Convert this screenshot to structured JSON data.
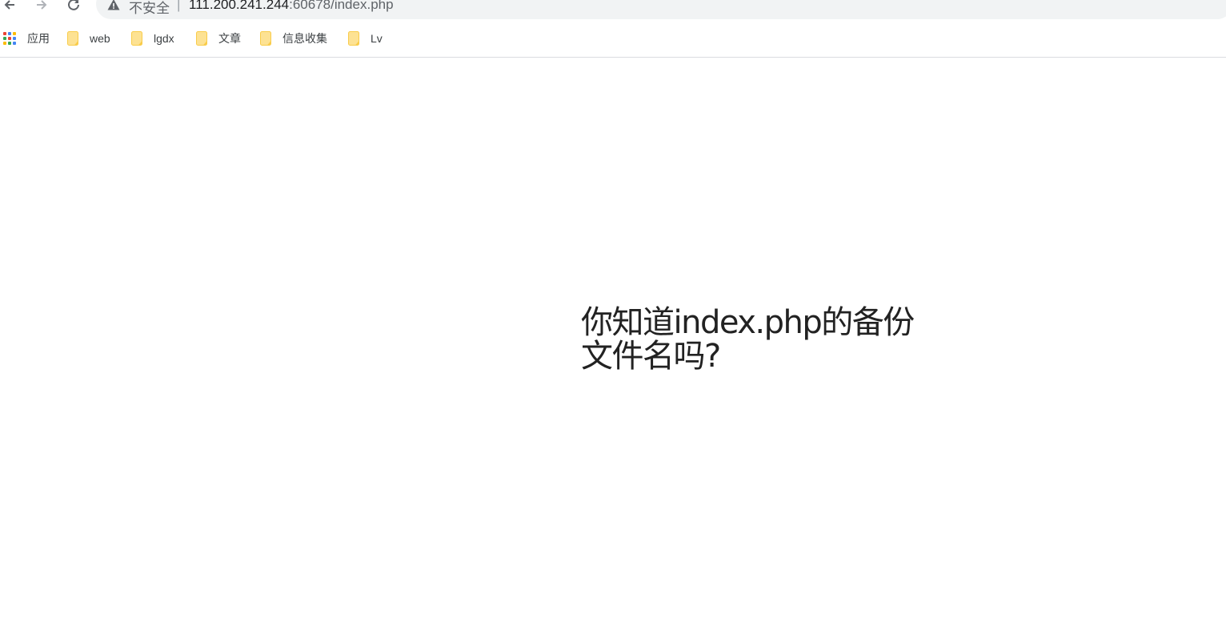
{
  "browser": {
    "security_label": "不安全",
    "separator": "|",
    "url_host": "111.200.241.244",
    "url_rest": ":60678/index.php"
  },
  "bookmarks": {
    "apps_label": "应用",
    "items": [
      {
        "label": "web"
      },
      {
        "label": "lgdx"
      },
      {
        "label": "文章"
      },
      {
        "label": "信息收集"
      },
      {
        "label": "Lv"
      }
    ]
  },
  "page": {
    "message": "你知道index.php的备份文件名吗?"
  },
  "colors": {
    "folder": "#fdd663",
    "omnibox_bg": "#f1f3f4",
    "text": "#222222"
  }
}
